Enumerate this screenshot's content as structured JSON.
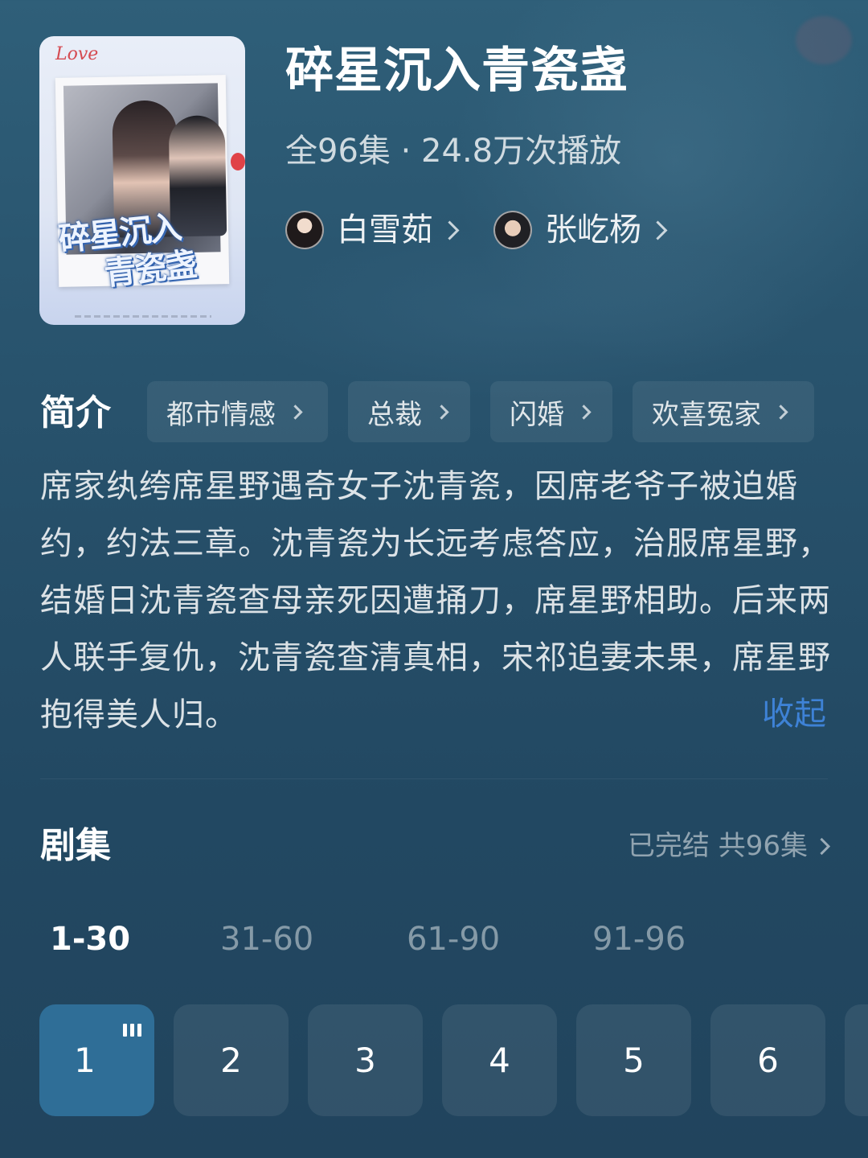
{
  "drama": {
    "title": "碎星沉入青瓷盏",
    "stats": "全96集 · 24.8万次播放",
    "poster_title_line1": "碎星沉入",
    "poster_title_line2": "青瓷盏",
    "poster_badge": "Love"
  },
  "cast": [
    {
      "name": "白雪茹",
      "icon": "actress-avatar"
    },
    {
      "name": "张屹杨",
      "icon": "actor-avatar"
    }
  ],
  "intro": {
    "label": "简介",
    "tags": [
      "都市情感",
      "总裁",
      "闪婚",
      "欢喜冤家"
    ],
    "synopsis": "席家纨绔席星野遇奇女子沈青瓷，因席老爷子被迫婚约，约法三章。沈青瓷为长远考虑答应，治服席星野，结婚日沈青瓷查母亲死因遭捅刀，席星野相助。后来两人联手复仇，沈青瓷查清真相，宋祁追妻未果，席星野抱得美人归。",
    "collapse_label": "收起"
  },
  "episodes": {
    "label": "剧集",
    "status": "已完结 共96集",
    "ranges": [
      "1-30",
      "31-60",
      "61-90",
      "91-96"
    ],
    "active_range": "1-30",
    "visible": [
      "1",
      "2",
      "3",
      "4",
      "5",
      "6"
    ],
    "current": "1"
  },
  "colors": {
    "background": "#2a5670",
    "accent_link": "#3e82d6",
    "active_episode": "#2f6e97"
  }
}
